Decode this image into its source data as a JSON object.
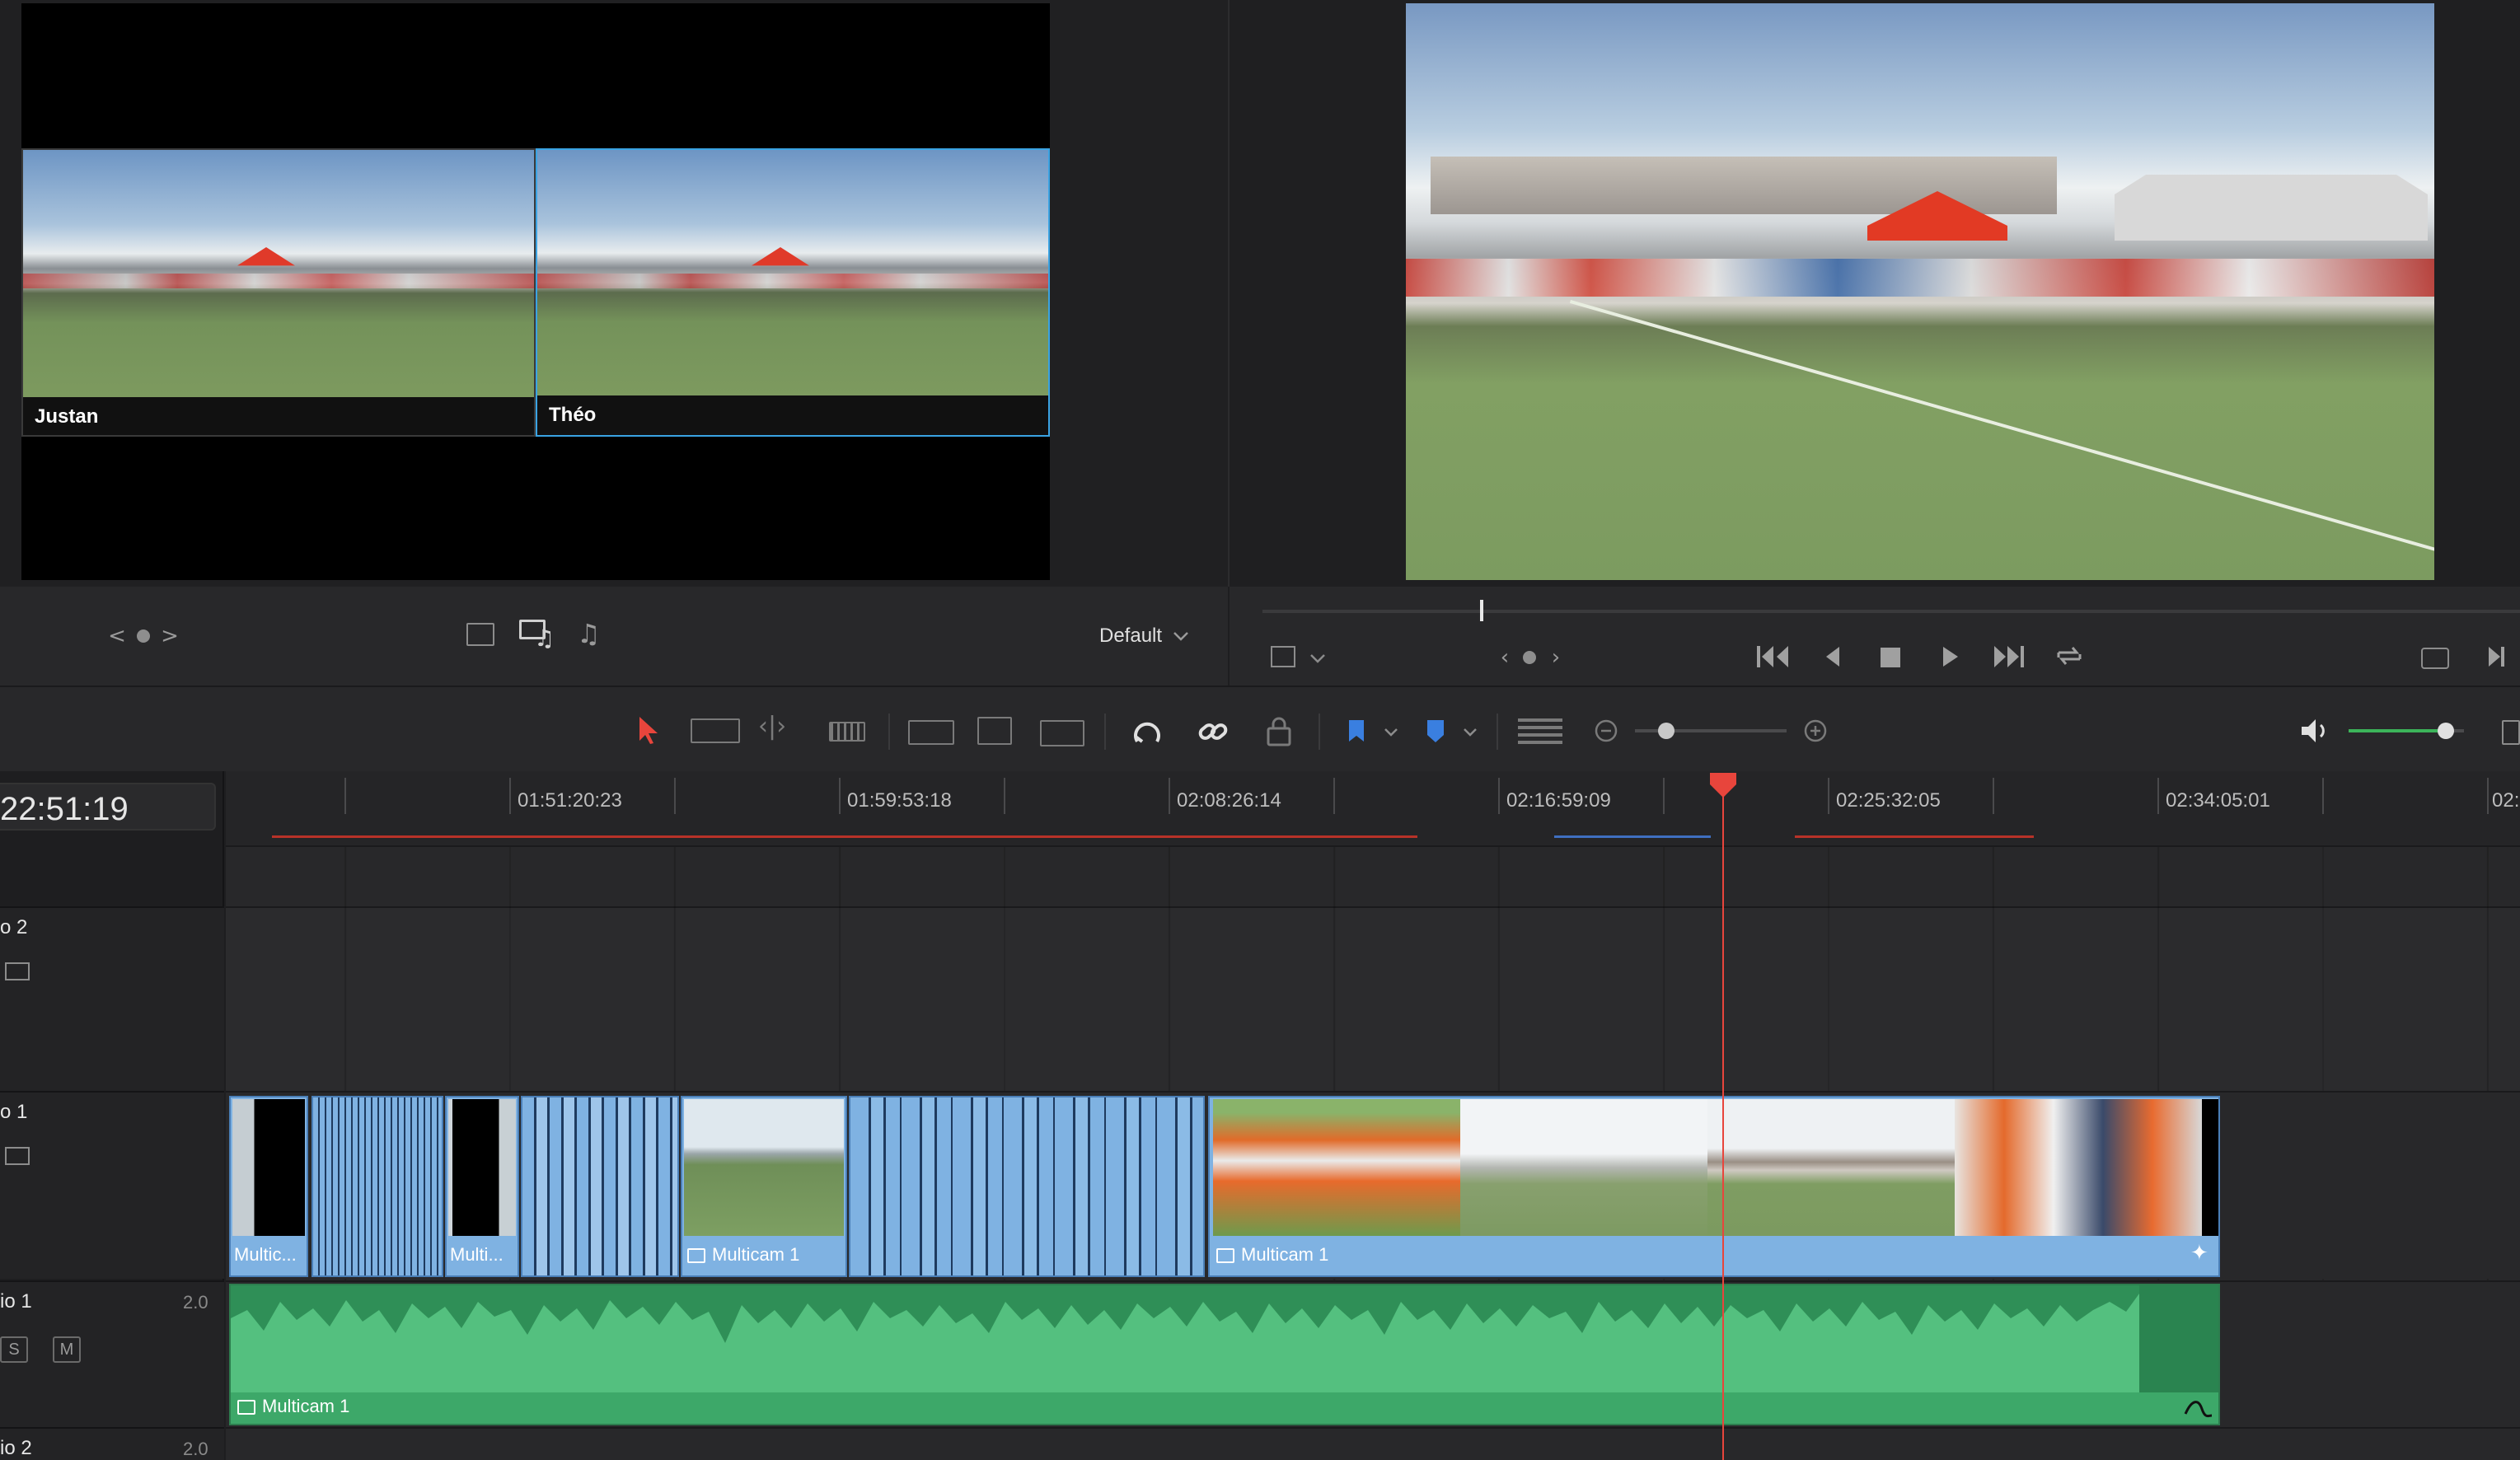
{
  "source_viewer": {
    "angles": [
      {
        "name": "Justan"
      },
      {
        "name": "Théo"
      }
    ],
    "nav_left": "<",
    "nav_right": ">",
    "preset_label": "Default"
  },
  "timeline": {
    "timecode": "22:51:19",
    "ruler_labels": [
      "01:51:20:23",
      "01:59:53:18",
      "02:08:26:14",
      "02:16:59:09",
      "02:25:32:05",
      "02:34:05:01",
      "02:"
    ],
    "tracks": {
      "video2": {
        "label": "o 2"
      },
      "video1": {
        "label": "o 1"
      },
      "audio1": {
        "label": "io 1",
        "channels": "2.0",
        "solo": "S",
        "mute": "M"
      },
      "audio2": {
        "label": "io 2",
        "channels": "2.0"
      }
    },
    "clips": {
      "v1_small_a": "Multic...",
      "v1_small_b": "Multi...",
      "v1_mid": "Multicam 1",
      "v1_main": "Multicam 1",
      "a1_main": "Multicam 1"
    }
  },
  "colors": {
    "accent_blue": "#4ba3e8",
    "playhead": "#e8453c",
    "clip_blue": "#7fb2e2",
    "audio_green": "#3da869",
    "volume_green": "#3cb45a"
  },
  "icons": [
    "chevron-left-icon",
    "dot-icon",
    "chevron-right-icon",
    "single-view-icon",
    "video-audio-icon",
    "audio-icon",
    "chevron-down-icon",
    "crop-icon",
    "skip-start-icon",
    "step-back-icon",
    "stop-icon",
    "play-icon",
    "skip-end-icon",
    "loop-icon",
    "fullscreen-icon",
    "next-icon",
    "select-tool-icon",
    "trim-tool-icon",
    "dynamic-trim-icon",
    "blade-tool-icon",
    "insert-icon",
    "overwrite-icon",
    "replace-icon",
    "snap-icon",
    "link-icon",
    "lock-icon",
    "flag-icon",
    "marker-icon",
    "track-height-icon",
    "zoom-out-icon",
    "zoom-in-icon",
    "speaker-icon"
  ]
}
